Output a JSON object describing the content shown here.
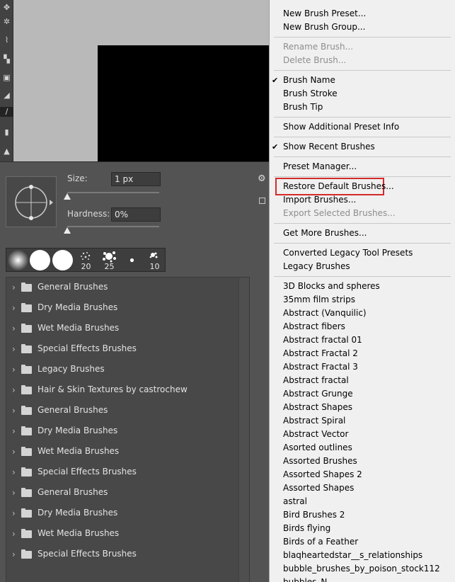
{
  "toolbar": {
    "tools": [
      {
        "icon": "move-icon",
        "glyph": "✥"
      },
      {
        "icon": "magic-wand-icon",
        "glyph": "✲"
      },
      {
        "icon": "eyedropper-icon",
        "glyph": "⌇"
      },
      {
        "icon": "healing-icon",
        "glyph": "▚"
      },
      {
        "icon": "stamp-icon",
        "glyph": "▣"
      },
      {
        "icon": "eraser-icon",
        "glyph": "◢"
      },
      {
        "icon": "brush-icon",
        "glyph": "∕"
      },
      {
        "icon": "gradient-icon",
        "glyph": "▮"
      },
      {
        "icon": "pen-icon",
        "glyph": "▲"
      }
    ]
  },
  "brush_settings": {
    "size_label": "Size:",
    "size_value": "1 px",
    "size_fraction": 0.0,
    "hardness_label": "Hardness:",
    "hardness_value": "0%",
    "hardness_fraction": 0.0
  },
  "recent_brushes": [
    {
      "kind": "soft-round",
      "size": ""
    },
    {
      "kind": "hard-round",
      "size": ""
    },
    {
      "kind": "hard-round",
      "size": ""
    },
    {
      "kind": "spatter",
      "size": "20"
    },
    {
      "kind": "splat",
      "size": "25"
    },
    {
      "kind": "dot",
      "size": ""
    },
    {
      "kind": "splat-small",
      "size": "10"
    }
  ],
  "brush_groups": [
    "General Brushes",
    "Dry Media Brushes",
    "Wet Media Brushes",
    "Special Effects Brushes",
    "Legacy Brushes",
    "Hair & Skin Textures by castrochew",
    "General Brushes",
    "Dry Media Brushes",
    "Wet Media Brushes",
    "Special Effects Brushes",
    "General Brushes",
    "Dry Media Brushes",
    "Wet Media Brushes",
    "Special Effects Brushes"
  ],
  "menu": {
    "items": [
      {
        "label": "New Brush Preset...",
        "enabled": true,
        "checked": false
      },
      {
        "label": "New Brush Group...",
        "enabled": true,
        "checked": false
      },
      {
        "separator": true
      },
      {
        "label": "Rename Brush...",
        "enabled": false,
        "checked": false
      },
      {
        "label": "Delete Brush...",
        "enabled": false,
        "checked": false
      },
      {
        "separator": true
      },
      {
        "label": "Brush Name",
        "enabled": true,
        "checked": true
      },
      {
        "label": "Brush Stroke",
        "enabled": true,
        "checked": false
      },
      {
        "label": "Brush Tip",
        "enabled": true,
        "checked": false
      },
      {
        "separator": true
      },
      {
        "label": "Show Additional Preset Info",
        "enabled": true,
        "checked": false
      },
      {
        "separator": true
      },
      {
        "label": "Show Recent Brushes",
        "enabled": true,
        "checked": true
      },
      {
        "separator": true
      },
      {
        "label": "Preset Manager...",
        "enabled": true,
        "checked": false
      },
      {
        "separator": true
      },
      {
        "label": "Restore Default Brushes...",
        "enabled": true,
        "checked": false,
        "highlighted": true
      },
      {
        "label": "Import Brushes...",
        "enabled": true,
        "checked": false
      },
      {
        "label": "Export Selected Brushes...",
        "enabled": false,
        "checked": false
      },
      {
        "separator": true
      },
      {
        "label": "Get More Brushes...",
        "enabled": true,
        "checked": false
      },
      {
        "separator": true
      },
      {
        "label": "Converted Legacy Tool Presets",
        "enabled": true,
        "checked": false
      },
      {
        "label": "Legacy Brushes",
        "enabled": true,
        "checked": false
      },
      {
        "separator": true
      },
      {
        "label": "3D Blocks and spheres",
        "enabled": true,
        "checked": false
      },
      {
        "label": "35mm film strips",
        "enabled": true,
        "checked": false
      },
      {
        "label": "Abstract (Vanquilic)",
        "enabled": true,
        "checked": false
      },
      {
        "label": "Abstract fibers",
        "enabled": true,
        "checked": false
      },
      {
        "label": "Abstract fractal 01",
        "enabled": true,
        "checked": false
      },
      {
        "label": "Abstract Fractal 2",
        "enabled": true,
        "checked": false
      },
      {
        "label": "Abstract Fractal 3",
        "enabled": true,
        "checked": false
      },
      {
        "label": "Abstract fractal",
        "enabled": true,
        "checked": false
      },
      {
        "label": "Abstract Grunge",
        "enabled": true,
        "checked": false
      },
      {
        "label": "Abstract Shapes",
        "enabled": true,
        "checked": false
      },
      {
        "label": "Abstract Spiral",
        "enabled": true,
        "checked": false
      },
      {
        "label": "Abstract Vector",
        "enabled": true,
        "checked": false
      },
      {
        "label": "Asorted outlines",
        "enabled": true,
        "checked": false
      },
      {
        "label": "Assorted Brushes",
        "enabled": true,
        "checked": false
      },
      {
        "label": "Assorted Shapes 2",
        "enabled": true,
        "checked": false
      },
      {
        "label": "Assorted Shapes",
        "enabled": true,
        "checked": false
      },
      {
        "label": "astral",
        "enabled": true,
        "checked": false
      },
      {
        "label": "Bird Brushes 2",
        "enabled": true,
        "checked": false
      },
      {
        "label": "Birds flying",
        "enabled": true,
        "checked": false
      },
      {
        "label": "Birds of a Feather",
        "enabled": true,
        "checked": false
      },
      {
        "label": "blaqheartedstar__s_relationships",
        "enabled": true,
        "checked": false
      },
      {
        "label": "bubble_brushes_by_poison_stock112",
        "enabled": true,
        "checked": false
      },
      {
        "label": "bubbles_N",
        "enabled": true,
        "checked": false
      }
    ]
  },
  "colors": {
    "highlight_box": "#d42a2a",
    "disabled_text": "#8d8d8d"
  }
}
